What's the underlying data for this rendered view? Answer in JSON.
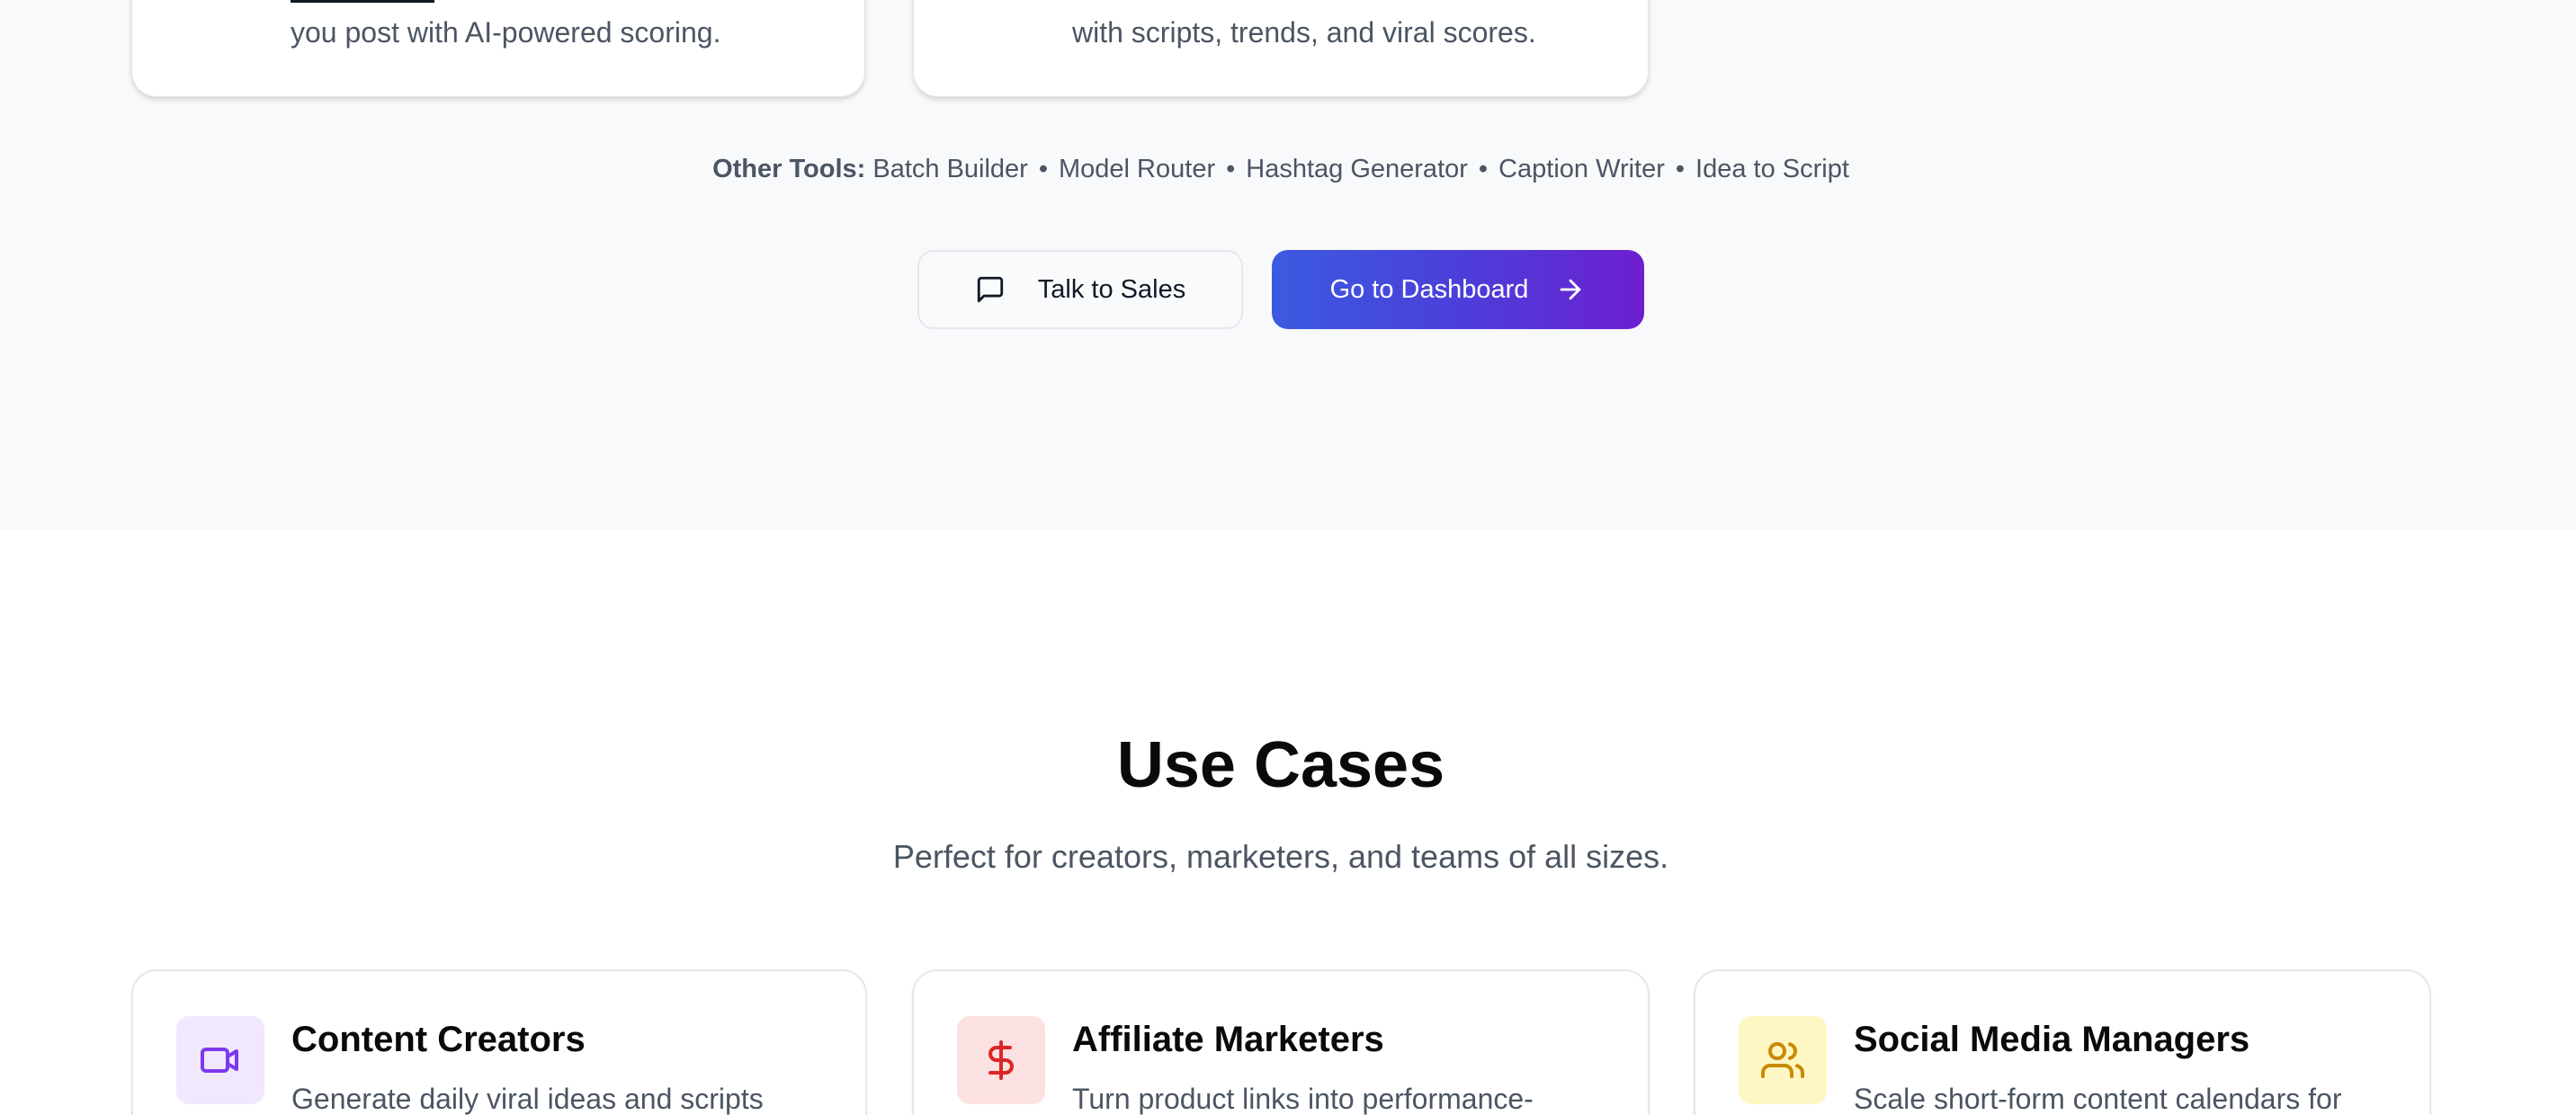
{
  "tools": {
    "card1_desc_line": "you post with AI-powered scoring.",
    "card2_desc_line": "with scripts, trends, and viral scores.",
    "other_label": "Other Tools:",
    "other_items": [
      "Batch Builder",
      "Model Router",
      "Hashtag Generator",
      "Caption Writer",
      "Idea to Script"
    ],
    "separator": "•"
  },
  "cta": {
    "sales_label": "Talk to Sales",
    "sales_icon": "message-square-icon",
    "dashboard_label": "Go to Dashboard",
    "dashboard_icon": "arrow-right-icon"
  },
  "use_cases": {
    "title": "Use Cases",
    "subtitle": "Perfect for creators, marketers, and teams of all sizes.",
    "items": [
      {
        "title": "Content Creators",
        "desc": "Generate daily viral ideas and scripts",
        "icon": "video-icon",
        "color": "#7c3aed"
      },
      {
        "title": "Affiliate Marketers",
        "desc": "Turn product links into performance-",
        "icon": "dollar-sign-icon",
        "color": "#dc2626"
      },
      {
        "title": "Social Media Managers",
        "desc": "Scale short-form content calendars for",
        "icon": "users-icon",
        "color": "#ca8a04"
      }
    ]
  },
  "colors": {
    "gradient_start": "#3b5be0",
    "gradient_end": "#6d1fd0",
    "section_bg": "#f8f9fb"
  }
}
